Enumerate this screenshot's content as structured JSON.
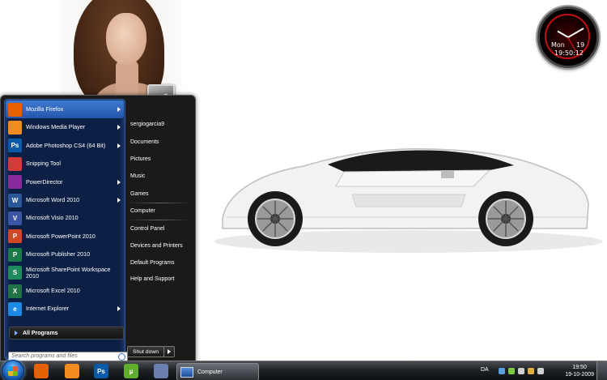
{
  "desktop": {
    "clock_gadget": {
      "day": "Mon",
      "date": "19",
      "time": "19:50:12"
    }
  },
  "start_menu": {
    "programs": [
      {
        "label": "Mozilla Firefox",
        "icon": "firefox-icon",
        "color": "#e66000",
        "has_submenu": true,
        "highlighted": true
      },
      {
        "label": "Windows Media Player",
        "icon": "media-player-icon",
        "color": "#f28b20",
        "has_submenu": true
      },
      {
        "label": "Adobe Photoshop CS4 (64 Bit)",
        "icon": "photoshop-icon",
        "color": "#0a5aa8",
        "has_submenu": true,
        "glyph": "Ps"
      },
      {
        "label": "Snipping Tool",
        "icon": "scissors-icon",
        "color": "#d33b3b",
        "has_submenu": false
      },
      {
        "label": "PowerDirector",
        "icon": "powerdirector-icon",
        "color": "#8a2b9c",
        "has_submenu": true
      },
      {
        "label": "Microsoft Word 2010",
        "icon": "word-icon",
        "color": "#2b5797",
        "has_submenu": true,
        "glyph": "W"
      },
      {
        "label": "Microsoft Visio 2010",
        "icon": "visio-icon",
        "color": "#3955a3",
        "has_submenu": false,
        "glyph": "V"
      },
      {
        "label": "Microsoft PowerPoint 2010",
        "icon": "powerpoint-icon",
        "color": "#d24726",
        "has_submenu": false,
        "glyph": "P"
      },
      {
        "label": "Microsoft Publisher 2010",
        "icon": "publisher-icon",
        "color": "#1b7a4a",
        "has_submenu": false,
        "glyph": "P"
      },
      {
        "label": "Microsoft SharePoint Workspace 2010",
        "icon": "sharepoint-icon",
        "color": "#1f8a5a",
        "has_submenu": false,
        "glyph": "S"
      },
      {
        "label": "Microsoft Excel 2010",
        "icon": "excel-icon",
        "color": "#217346",
        "has_submenu": false,
        "glyph": "X"
      },
      {
        "label": "Internet Explorer",
        "icon": "internet-explorer-icon",
        "color": "#1e88e5",
        "has_submenu": true,
        "glyph": "e"
      }
    ],
    "all_programs_label": "All Programs",
    "search_placeholder": "Search programs and files",
    "right_links": [
      {
        "label": "sergiogarcia9",
        "name": "user-folder"
      },
      {
        "label": "Documents",
        "name": "documents"
      },
      {
        "label": "Pictures",
        "name": "pictures"
      },
      {
        "label": "Music",
        "name": "music"
      },
      {
        "label": "Games",
        "name": "games"
      },
      {
        "label": "Computer",
        "name": "computer"
      },
      {
        "label": "Control Panel",
        "name": "control-panel"
      },
      {
        "label": "Devices and Printers",
        "name": "devices-and-printers"
      },
      {
        "label": "Default Programs",
        "name": "default-programs"
      },
      {
        "label": "Help and Support",
        "name": "help-and-support"
      }
    ],
    "shutdown_label": "Shut down"
  },
  "taskbar": {
    "pinned": [
      {
        "name": "firefox-icon",
        "color": "#e66000"
      },
      {
        "name": "media-player-icon",
        "color": "#f28b20"
      },
      {
        "name": "photoshop-icon",
        "color": "#0a5aa8",
        "glyph": "Ps"
      },
      {
        "name": "utorrent-icon",
        "color": "#5fae2e",
        "glyph": "µ"
      },
      {
        "name": "firefox-alt-icon",
        "color": "#6a7fb0"
      }
    ],
    "active_task": "Computer",
    "tray": {
      "language": "DA",
      "time": "19:50",
      "date": "19-10-2009"
    }
  }
}
